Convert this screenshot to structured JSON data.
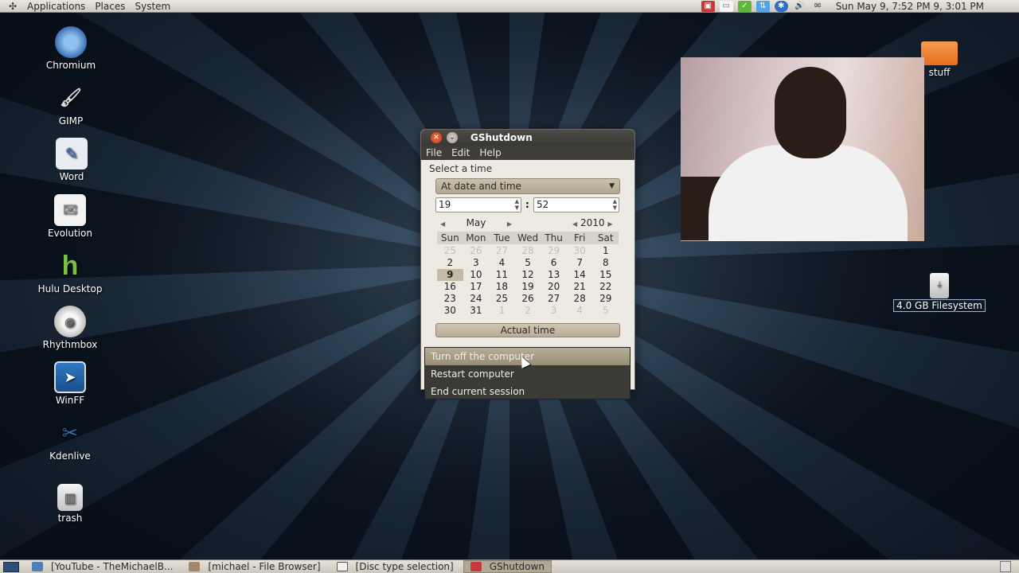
{
  "top_panel": {
    "menus": [
      "Applications",
      "Places",
      "System"
    ],
    "clock": "Sun May  9,  7:52 PM  9, 3:01 PM"
  },
  "desktop_icons": [
    {
      "label": "Chromium",
      "icon": "chromium-icon"
    },
    {
      "label": "GIMP",
      "icon": "gimp-icon"
    },
    {
      "label": "Word",
      "icon": "word-icon"
    },
    {
      "label": "Evolution",
      "icon": "evolution-icon"
    },
    {
      "label": "Hulu Desktop",
      "icon": "hulu-icon"
    },
    {
      "label": "Rhythmbox",
      "icon": "rhythmbox-icon"
    },
    {
      "label": "WinFF",
      "icon": "winff-icon"
    },
    {
      "label": "Kdenlive",
      "icon": "kdenlive-icon"
    },
    {
      "label": "trash",
      "icon": "trash-icon"
    }
  ],
  "right_icons": {
    "folder_label": "stuff",
    "usb_label": "4.0 GB Filesystem"
  },
  "window": {
    "title": "GShutdown",
    "menus": [
      "File",
      "Edit",
      "Help"
    ],
    "select_label": "Select a time",
    "combo_value": "At date and time",
    "hour": "19",
    "minute": "52",
    "colon": ":",
    "month": "May",
    "year": "2010",
    "weekdays": [
      "Sun",
      "Mon",
      "Tue",
      "Wed",
      "Thu",
      "Fri",
      "Sat"
    ],
    "weeks": [
      [
        "25",
        "26",
        "27",
        "28",
        "29",
        "30",
        "1"
      ],
      [
        "2",
        "3",
        "4",
        "5",
        "6",
        "7",
        "8"
      ],
      [
        "9",
        "10",
        "11",
        "12",
        "13",
        "14",
        "15"
      ],
      [
        "16",
        "17",
        "18",
        "19",
        "20",
        "21",
        "22"
      ],
      [
        "23",
        "24",
        "25",
        "26",
        "27",
        "28",
        "29"
      ],
      [
        "30",
        "31",
        "1",
        "2",
        "3",
        "4",
        "5"
      ]
    ],
    "selected_day": "9",
    "actual_time_label": "Actual time"
  },
  "dropdown": {
    "options": [
      "Turn off the computer",
      "Restart computer",
      "End current session"
    ],
    "highlighted": 0
  },
  "bottom_panel": {
    "tasks": [
      {
        "label": "[YouTube - TheMichaelB...",
        "active": false
      },
      {
        "label": "[michael - File Browser]",
        "active": false
      },
      {
        "label": "[Disc type selection]",
        "active": false
      },
      {
        "label": "GShutdown",
        "active": true
      }
    ]
  },
  "colors": {
    "panel": "#e0dcd4",
    "window_title": "#3a3835",
    "accent": "#b6ad98",
    "close_button": "#e4582c"
  }
}
